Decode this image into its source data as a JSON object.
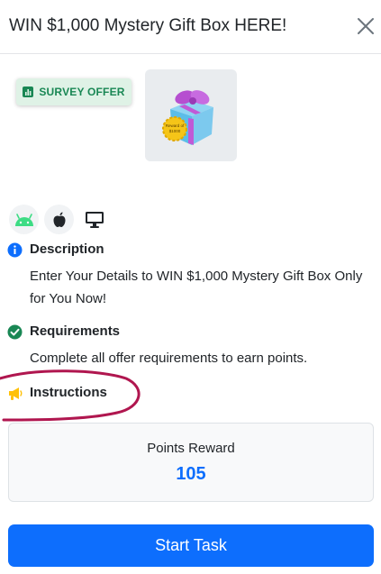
{
  "header": {
    "title": "WIN $1,000 Mystery Gift Box HERE!",
    "close_icon": "close-icon"
  },
  "offer": {
    "badge_label": "SURVEY OFFER",
    "badge_icon": "bar-chart-icon",
    "image": "mystery-gift-box-image",
    "image_seal_text": "Reward of $1000"
  },
  "platforms": [
    {
      "name": "android",
      "icon": "android-icon"
    },
    {
      "name": "apple",
      "icon": "apple-icon"
    },
    {
      "name": "desktop",
      "icon": "desktop-icon"
    }
  ],
  "sections": {
    "description": {
      "title": "Description",
      "text": "Enter Your Details to WIN $1,000 Mystery Gift Box Only for You Now!",
      "icon": "info-icon"
    },
    "requirements": {
      "title": "Requirements",
      "text": "Complete all offer requirements to earn points.",
      "icon": "check-circle-icon"
    },
    "instructions": {
      "title": "Instructions",
      "icon": "megaphone-icon"
    }
  },
  "reward": {
    "label": "Points Reward",
    "value": "105"
  },
  "actions": {
    "start_label": "Start Task"
  },
  "colors": {
    "primary": "#0d6efd",
    "success": "#198754",
    "badge_bg": "#dff2e6",
    "info": "#0d6efd",
    "warning": "#ffc107",
    "android": "#3ddc84",
    "annotation": "#b0164f"
  }
}
